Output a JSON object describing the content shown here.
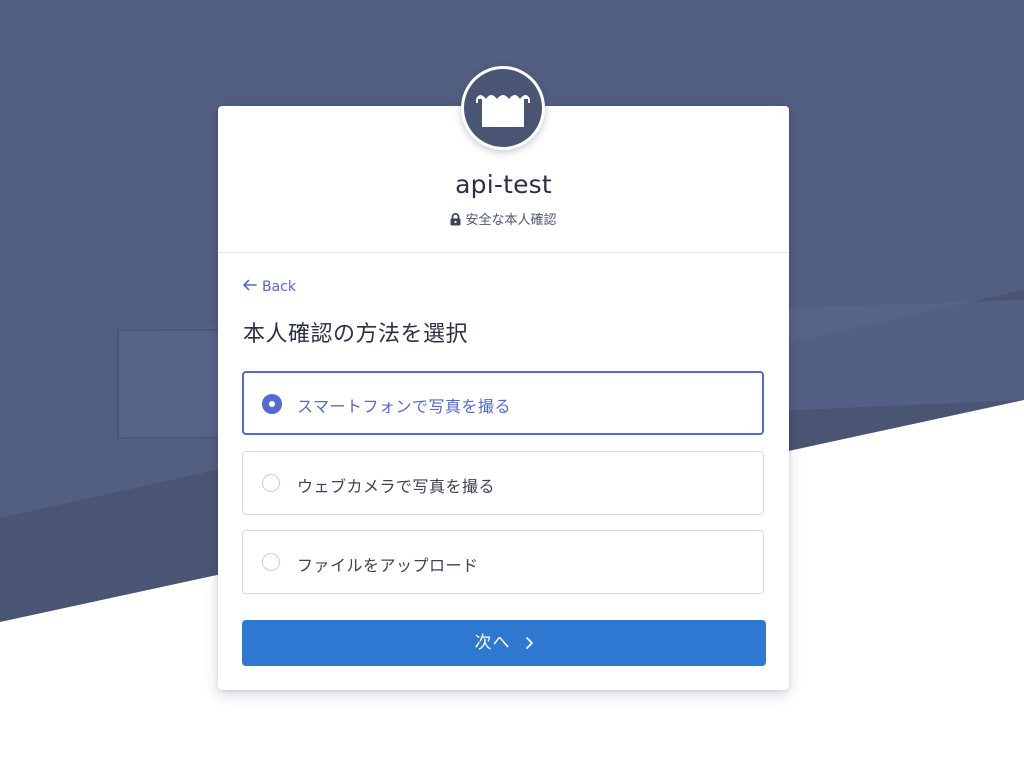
{
  "colors": {
    "background_dark": "#4a5573",
    "background_stripe": "#5b6890",
    "accent": "#5469d4",
    "button": "#2f78d1"
  },
  "header": {
    "logo_icon": "storefront-icon",
    "app_name": "api-test",
    "secure_icon": "lock-icon",
    "secure_text": "安全な本人確認"
  },
  "body": {
    "back_icon": "arrow-left-icon",
    "back_label": "Back",
    "title": "本人確認の方法を選択",
    "options": [
      {
        "label": "スマートフォンで写真を撮る",
        "selected": true
      },
      {
        "label": "ウェブカメラで写真を撮る",
        "selected": false
      },
      {
        "label": "ファイルをアップロード",
        "selected": false
      }
    ],
    "next_label": "次へ",
    "next_icon": "chevron-right-icon"
  }
}
